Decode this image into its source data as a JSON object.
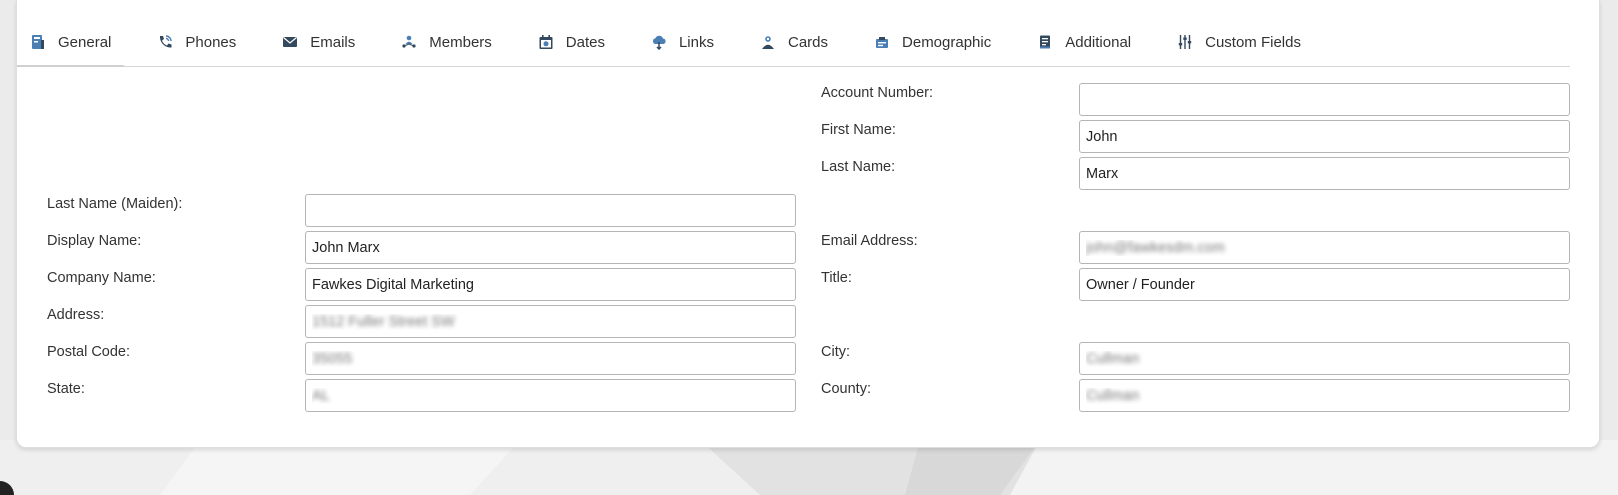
{
  "tabs": [
    {
      "label": "General",
      "icon": "general-icon",
      "active": true
    },
    {
      "label": "Phones",
      "icon": "phone-icon"
    },
    {
      "label": "Emails",
      "icon": "envelope-icon"
    },
    {
      "label": "Members",
      "icon": "members-icon"
    },
    {
      "label": "Dates",
      "icon": "calendar-icon"
    },
    {
      "label": "Links",
      "icon": "cloud-link-icon"
    },
    {
      "label": "Cards",
      "icon": "cards-icon"
    },
    {
      "label": "Demographic",
      "icon": "demographic-icon"
    },
    {
      "label": "Additional",
      "icon": "additional-icon"
    },
    {
      "label": "Custom Fields",
      "icon": "sliders-icon"
    }
  ],
  "right": {
    "account_number": {
      "label": "Account Number:",
      "value": ""
    },
    "first_name": {
      "label": "First Name:",
      "value": "John"
    },
    "last_name": {
      "label": "Last Name:",
      "value": "Marx"
    },
    "email": {
      "label": "Email Address:",
      "value": "john@fawkesdm.com"
    },
    "title": {
      "label": "Title:",
      "value": "Owner / Founder"
    },
    "city": {
      "label": "City:",
      "value": "Cullman"
    },
    "county": {
      "label": "County:",
      "value": "Cullman"
    }
  },
  "left": {
    "maiden": {
      "label": "Last Name (Maiden):",
      "value": ""
    },
    "display_name": {
      "label": "Display Name:",
      "value": "John Marx"
    },
    "company": {
      "label": "Company Name:",
      "value": "Fawkes Digital Marketing"
    },
    "address": {
      "label": "Address:",
      "value": "1512 Fuller Street SW"
    },
    "postal": {
      "label": "Postal Code:",
      "value": "35055"
    },
    "state": {
      "label": "State:",
      "value": "AL"
    }
  },
  "colors": {
    "accent": "#4a7fb5",
    "icon_dark": "#34495e"
  }
}
